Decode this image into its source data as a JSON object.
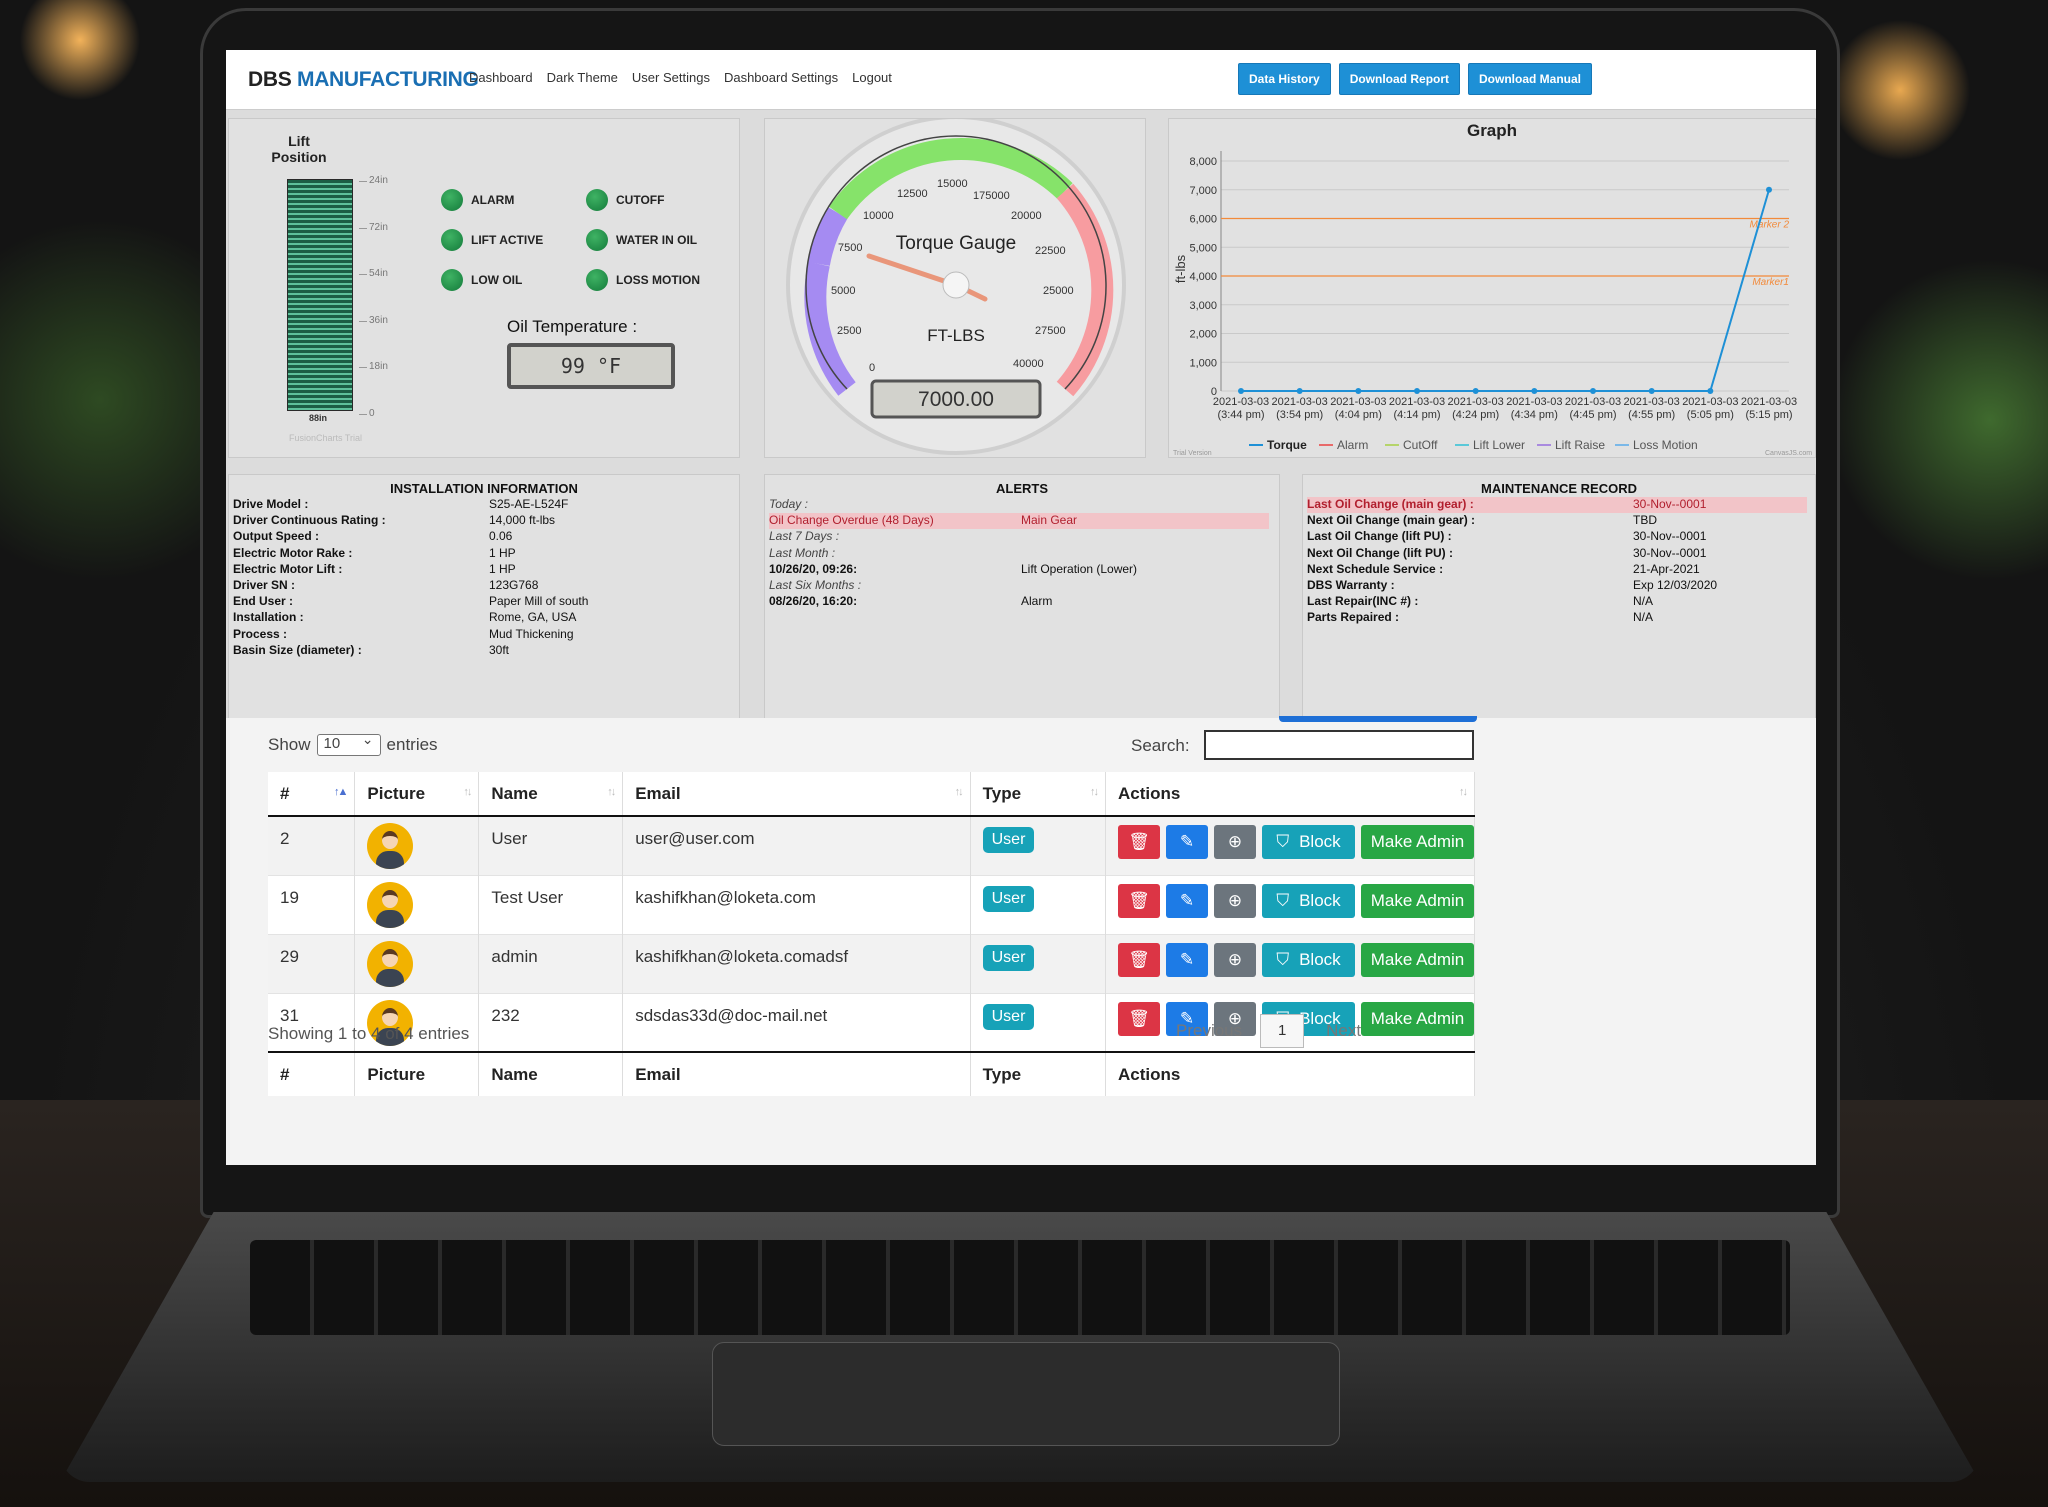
{
  "brand": {
    "dbs": "DBS",
    "mfg": "MANUFACTURING"
  },
  "nav": {
    "links": [
      "Dashboard",
      "Dark Theme",
      "User Settings",
      "Dashboard Settings",
      "Logout"
    ],
    "buttons": [
      "Data History",
      "Download Report",
      "Download Manual"
    ]
  },
  "lift": {
    "title": "Lift Position",
    "scale": [
      "24in",
      "72in",
      "54in",
      "36in",
      "18in",
      "0"
    ],
    "bottom": "88in",
    "watermark": "FusionCharts Trial",
    "indicators": [
      "ALARM",
      "CUTOFF",
      "LIFT ACTIVE",
      "WATER IN OIL",
      "LOW OIL",
      "LOSS MOTION"
    ]
  },
  "oil": {
    "title": "Oil Temperature :",
    "value": "99 °F"
  },
  "gauge": {
    "title": "Torque Gauge",
    "unit": "FT-LBS",
    "value": "7000.00",
    "labels": [
      "0",
      "2500",
      "5000",
      "7500",
      "10000",
      "12500",
      "15000",
      "175000",
      "20000",
      "22500",
      "25000",
      "27500",
      "40000"
    ]
  },
  "graph": {
    "title": "Graph",
    "ylabel": "ft-lbs",
    "yticks": [
      "8,000",
      "7,000",
      "6,000",
      "5,000",
      "4,000",
      "3,000",
      "2,000",
      "1,000",
      "0"
    ],
    "marker1": "Marker1",
    "marker2": "Marker 2",
    "trial": "Trial Version",
    "credit": "CanvasJS.com",
    "legend": [
      "Torque",
      "Alarm",
      "CutOff",
      "Lift Lower",
      "Lift Raise",
      "Loss Motion"
    ]
  },
  "chart_data": {
    "type": "line",
    "title": "Graph",
    "ylabel": "ft-lbs",
    "ylim": [
      0,
      8000
    ],
    "x": [
      "2021-03-03 (3:44 pm)",
      "2021-03-03 (3:54 pm)",
      "2021-03-03 (4:04 pm)",
      "2021-03-03 (4:14 pm)",
      "2021-03-03 (4:24 pm)",
      "2021-03-03 (4:34 pm)",
      "2021-03-03 (4:45 pm)",
      "2021-03-03 (4:55 pm)",
      "2021-03-03 (5:05 pm)",
      "2021-03-03 (5:15 pm)"
    ],
    "series": [
      {
        "name": "Torque",
        "values": [
          0,
          0,
          0,
          0,
          0,
          0,
          0,
          0,
          0,
          7000
        ]
      }
    ],
    "markers": [
      {
        "name": "Marker1",
        "y": 4000
      },
      {
        "name": "Marker 2",
        "y": 6000
      }
    ],
    "grid": true,
    "legend": "bottom"
  },
  "install": {
    "title": "INSTALLATION INFORMATION",
    "rows": [
      [
        "Drive Model :",
        "S25-AE-L524F"
      ],
      [
        "Driver Continuous Rating :",
        "14,000 ft-lbs"
      ],
      [
        "Output Speed :",
        "0.06"
      ],
      [
        "Electric Motor Rake :",
        "1 HP"
      ],
      [
        "Electric Motor Lift :",
        "1 HP"
      ],
      [
        "Driver SN :",
        "123G768"
      ],
      [
        "End User :",
        "Paper Mill of south"
      ],
      [
        "Installation :",
        "Rome, GA, USA"
      ],
      [
        "Process :",
        "Mud Thickening"
      ],
      [
        "Basin Size (diameter) :",
        "30ft"
      ]
    ]
  },
  "alerts": {
    "title": "ALERTS",
    "rows": [
      [
        "Today :",
        ""
      ],
      [
        "Oil Change Overdue (48 Days)",
        "Main Gear"
      ],
      [
        "Last 7 Days :",
        ""
      ],
      [
        "Last Month :",
        ""
      ],
      [
        "10/26/20, 09:26:",
        "Lift Operation (Lower)"
      ],
      [
        "Last Six Months :",
        ""
      ],
      [
        "08/26/20, 16:20:",
        "Alarm"
      ]
    ]
  },
  "maint": {
    "title": "MAINTENANCE RECORD",
    "rows": [
      [
        "Last Oil Change (main gear) :",
        "30-Nov--0001"
      ],
      [
        "Next Oil Change (main gear) :",
        "TBD"
      ],
      [
        "Last Oil Change (lift PU) :",
        "30-Nov--0001"
      ],
      [
        "Next Oil Change (lift PU) :",
        "30-Nov--0001"
      ],
      [
        "Next Schedule Service :",
        "21-Apr-2021"
      ],
      [
        "DBS Warranty :",
        "Exp 12/03/2020"
      ],
      [
        "Last Repair(INC #) :",
        "N/A"
      ],
      [
        "Parts Repaired :",
        "N/A"
      ]
    ]
  },
  "table": {
    "show": "Show",
    "entries_value": "10",
    "entries": "entries",
    "search": "Search:",
    "headers": [
      "#",
      "Picture",
      "Name",
      "Email",
      "Type",
      "Actions"
    ],
    "rows": [
      {
        "id": "2",
        "name": "User",
        "email": "user@user.com",
        "type": "User"
      },
      {
        "id": "19",
        "name": "Test User",
        "email": "kashifkhan@loketa.com",
        "type": "User"
      },
      {
        "id": "29",
        "name": "admin",
        "email": "kashifkhan@loketa.comadsf",
        "type": "User"
      },
      {
        "id": "31",
        "name": "232",
        "email": "sdsdas33d@doc-mail.net",
        "type": "User"
      }
    ],
    "block": "Block",
    "make_admin": "Make Admin",
    "showing": "Showing 1 to 4 of 4 entries",
    "previous": "Previous",
    "page": "1",
    "next": "Next"
  },
  "colors": {
    "accent": "#1e90d6",
    "danger": "#dc3545",
    "primary": "#1d7be6",
    "info": "#17a2b8",
    "success": "#28a745",
    "secondary": "#6c757d",
    "indicator": "#1f8f47"
  }
}
